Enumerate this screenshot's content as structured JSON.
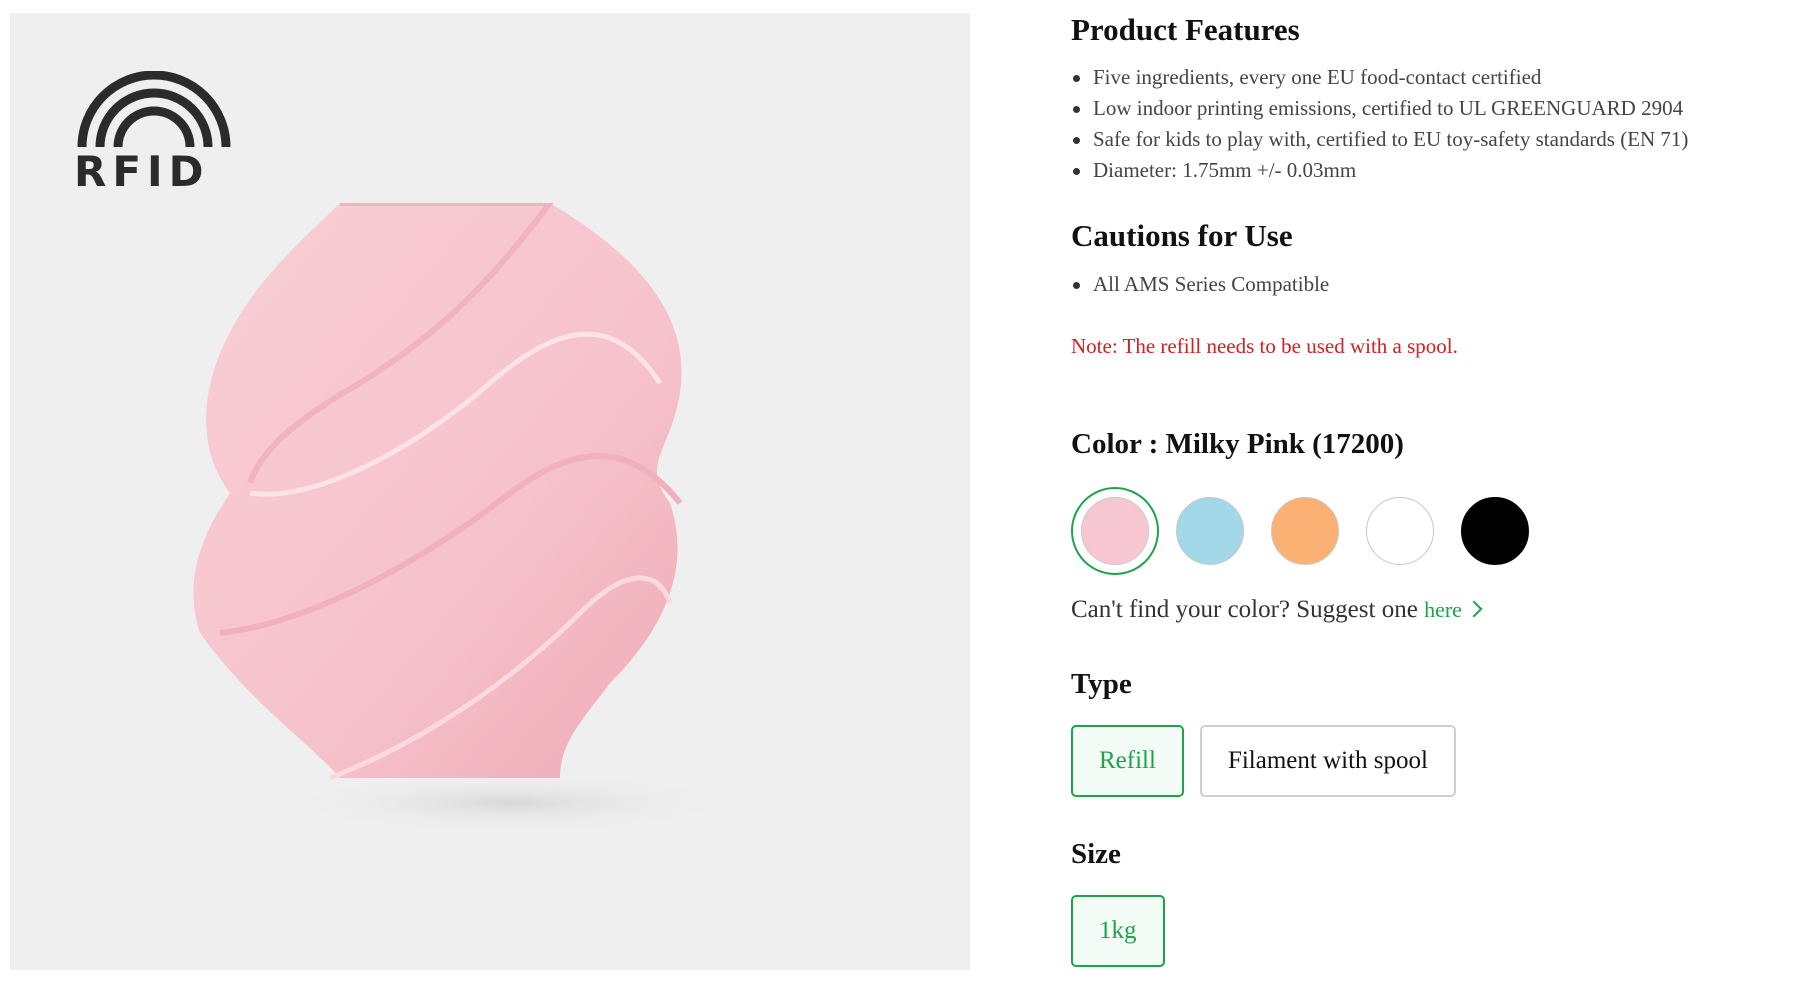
{
  "image": {
    "rfid_label": "RFID",
    "product_icon": "spiral-vase"
  },
  "features": {
    "title": "Product Features",
    "items": [
      "Five ingredients, every one EU food-contact certified",
      "Low indoor printing emissions, certified to UL GREENGUARD 2904",
      "Safe for kids to play with, certified to EU toy-safety standards (EN 71)",
      "Diameter: 1.75mm +/- 0.03mm"
    ]
  },
  "cautions": {
    "title": "Cautions for Use",
    "items": [
      "All AMS Series Compatible"
    ]
  },
  "note": "Note: The refill needs to be used with a spool.",
  "color": {
    "label": "Color : Milky Pink (17200)",
    "selected_index": 0,
    "swatches": [
      {
        "hex": "#f6c7d2"
      },
      {
        "hex": "#a2d8e8"
      },
      {
        "hex": "#fbb173"
      },
      {
        "hex": "#ffffff"
      },
      {
        "hex": "#000000"
      }
    ],
    "suggest_text": "Can't find your color? Suggest one ",
    "suggest_link": "here"
  },
  "type": {
    "label": "Type",
    "options": [
      "Refill",
      "Filament with spool"
    ],
    "selected_index": 0
  },
  "size": {
    "label": "Size",
    "options": [
      "1kg"
    ],
    "selected_index": 0
  },
  "colors": {
    "accent": "#1ea24a",
    "note": "#d0201f",
    "panel_bg": "#efefef"
  }
}
